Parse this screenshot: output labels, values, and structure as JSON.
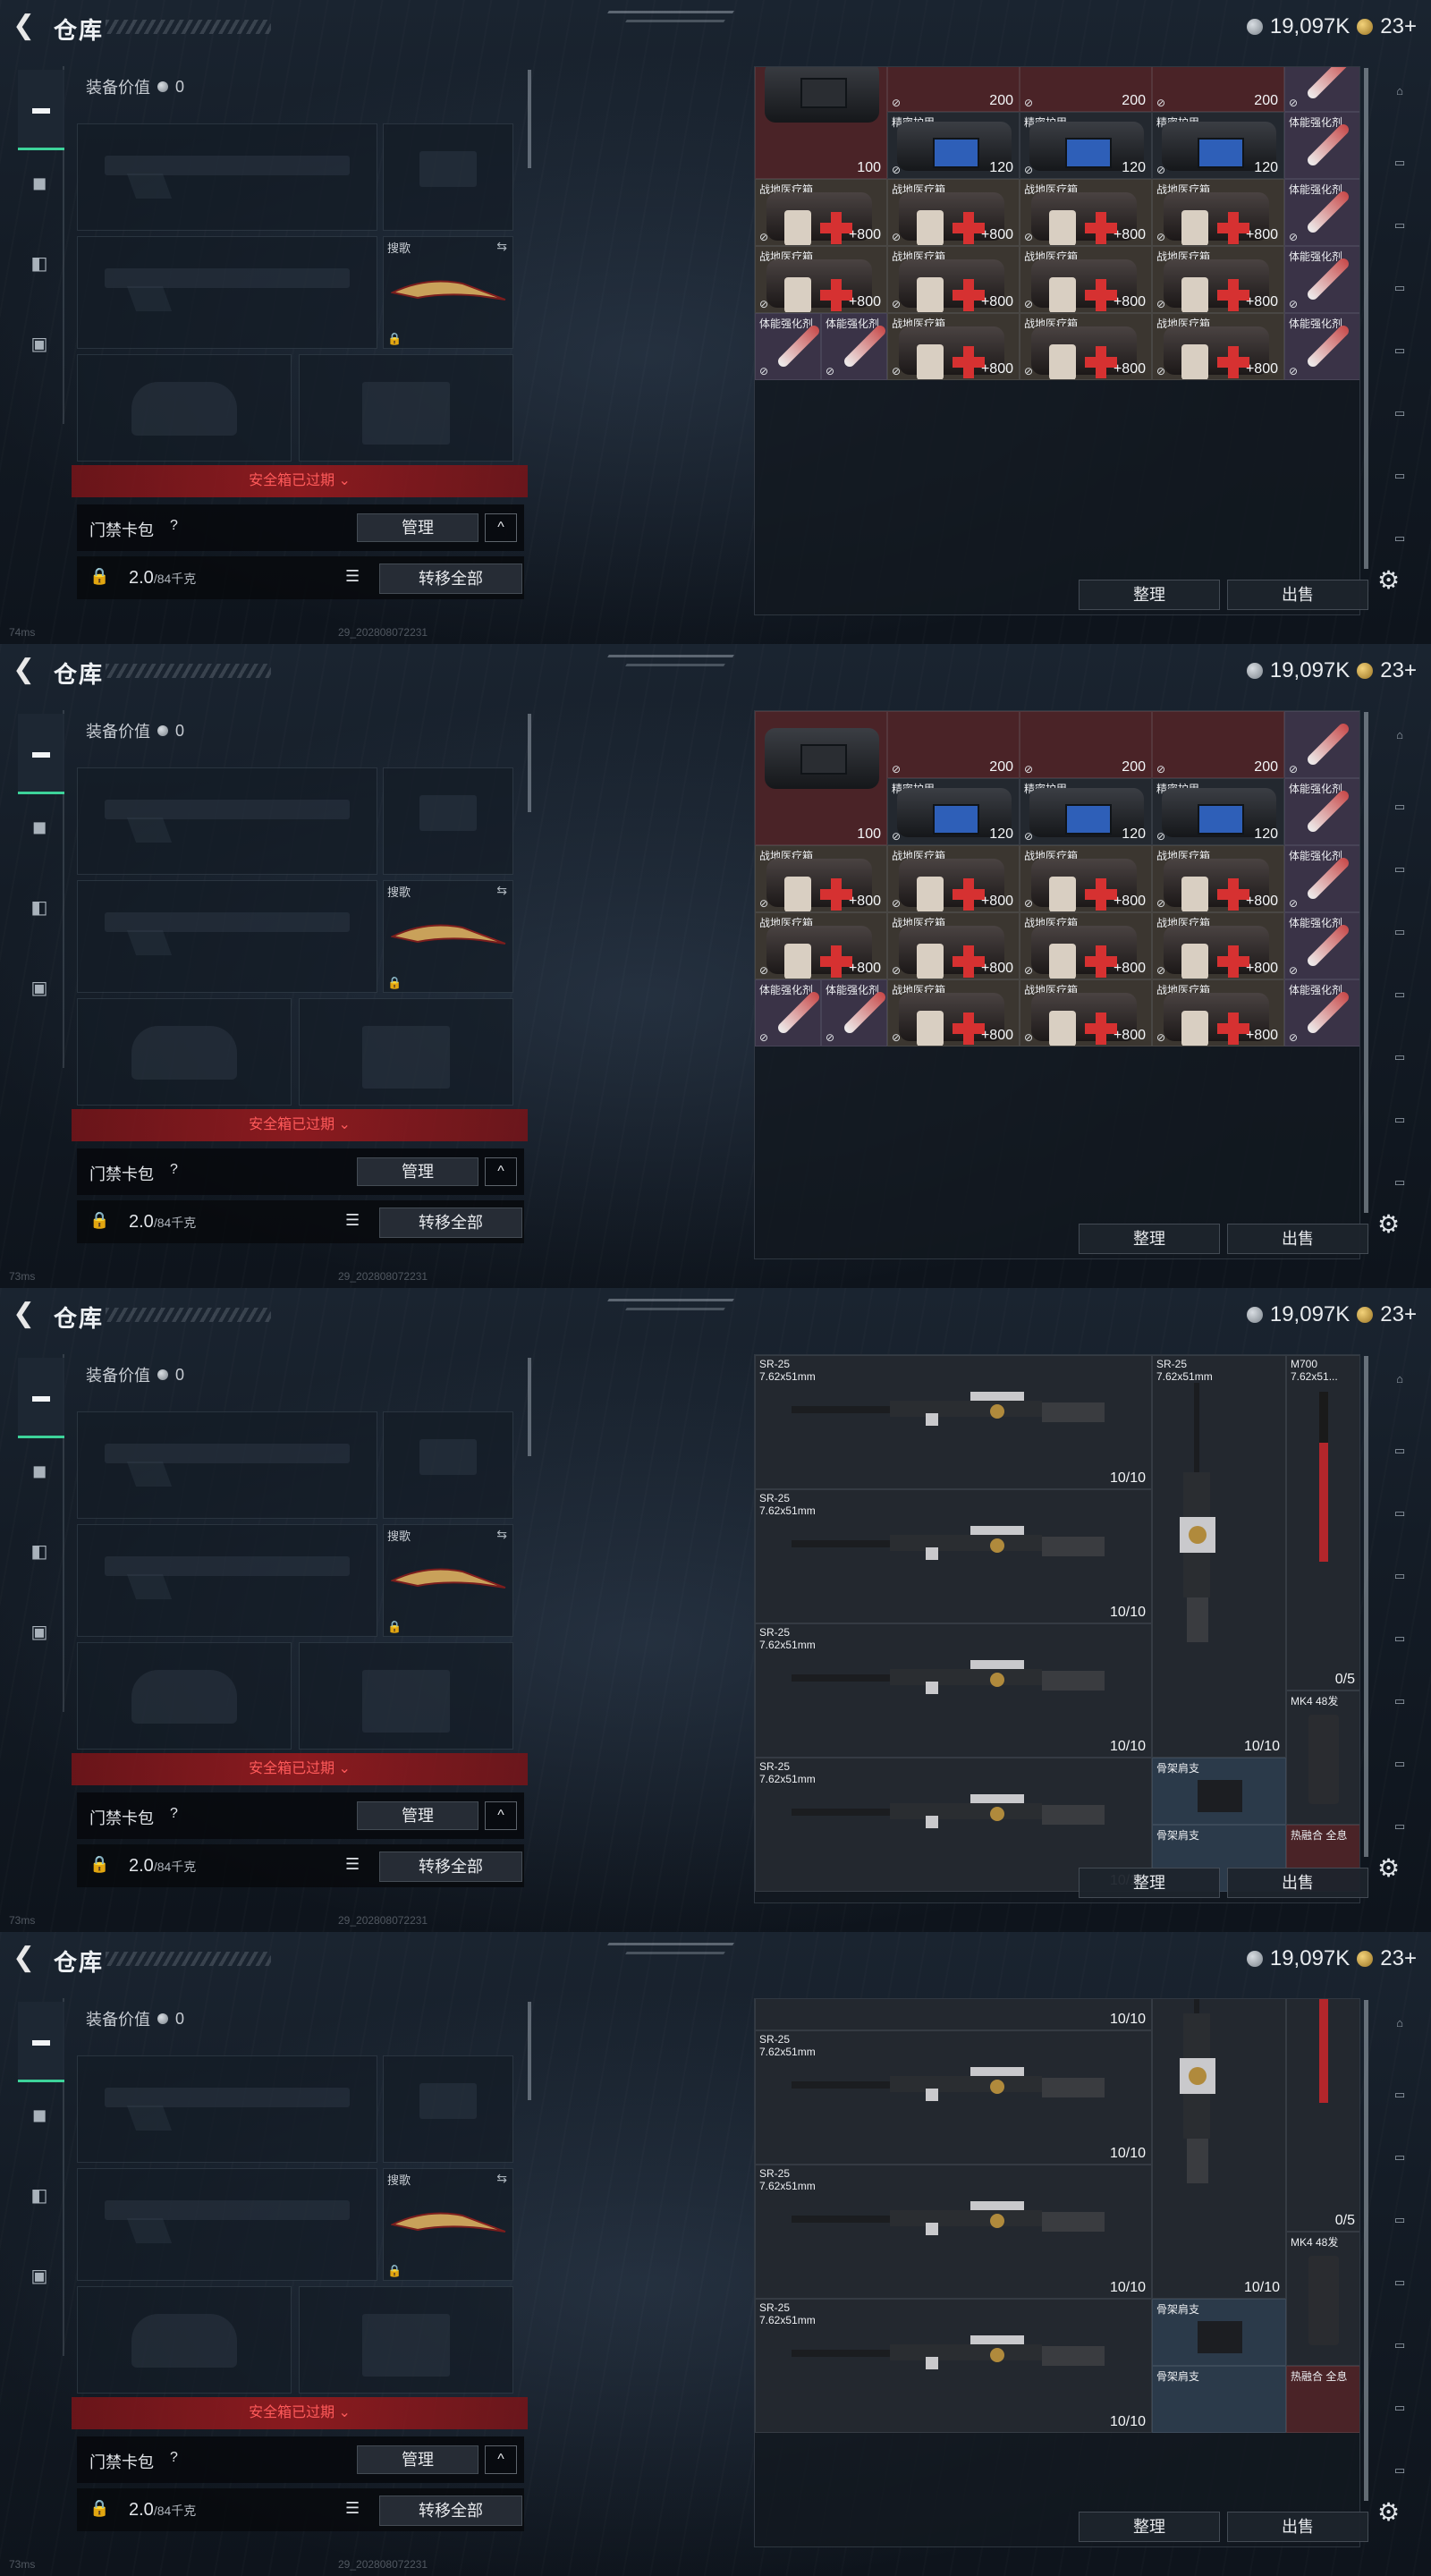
{
  "header": {
    "title": "仓库",
    "currency_silver": "19,097K",
    "currency_gold": "23+"
  },
  "equipment": {
    "value_label": "装备价值",
    "value": "0",
    "knife_label": "搜歌",
    "safebox_expired": "安全箱已过期",
    "card_pack_label": "门禁卡包",
    "help": "?",
    "manage_label": "管理",
    "collapse": "^",
    "weight_current": "2.0",
    "weight_max": "/84千克",
    "transfer_all": "转移全部"
  },
  "footer": {
    "sort_label": "整理",
    "sell_label": "出售"
  },
  "status": {
    "ping_1": "74ms",
    "ping_2": "73ms",
    "ping_3": "73ms",
    "ping_4": "73ms",
    "build": "29_202808072231"
  },
  "items": {
    "armor_name": "精密护甲",
    "medkit_name": "战地医疗箱",
    "stim_name": "体能强化剂",
    "rifle_name": "SR-25",
    "rifle_cal": "7.62x51mm",
    "m700_name": "M700",
    "m700_cal": "7.62x51...",
    "mag_name": "MK4 48发",
    "stock_name": "骨架肩支",
    "sight_name": "热融合 全息",
    "v100": "100",
    "v120": "120",
    "v200": "200",
    "v800": "+800",
    "ammo_full": "10/10",
    "ammo_05": "0/5"
  },
  "colors": {
    "accent": "#3dd39a",
    "alert": "#ff5a5a"
  }
}
